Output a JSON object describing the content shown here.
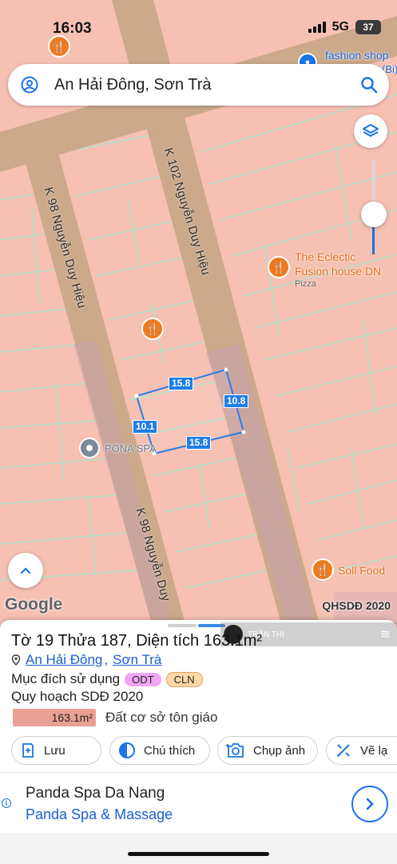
{
  "status": {
    "time": "16:03",
    "network": "5G",
    "battery": "37"
  },
  "search": {
    "query": "An Hải Đông, Sơn Trà"
  },
  "map": {
    "streets": {
      "left_upper": "K 98 Nguyễn Duy Hiệu",
      "center": "K 102 Nguyễn Duy Hiệu",
      "left_lower": "K 98 Nguyễn Duy"
    },
    "pois": {
      "fashion_shop": "fashion shop",
      "fashion_shop_suffix": "Bi",
      "eclectic": "The Eclectic Fusion house DN",
      "eclectic_type": "Pizza",
      "pona": "PONA SPA",
      "soll": "Soll Food"
    },
    "dimensions": {
      "top": "15.8",
      "right": "10.8",
      "left": "10.1",
      "bottom": "15.8"
    },
    "google": "Google",
    "plan_layer": "QHSDĐ 2020"
  },
  "sheet": {
    "title": "Tờ 19 Thửa 187, Diện tích 163.1m²",
    "address": {
      "ward": "An Hải Đông",
      "sep": ",",
      "district": "Sơn Trà"
    },
    "purpose_label": "Mục đích sử dụng",
    "badges": [
      {
        "text": "ODT",
        "color": "#f0a6f2"
      },
      {
        "text": "CLN",
        "color": "#ffd9a6"
      }
    ],
    "plan_label": "Quy hoạch SDĐ 2020",
    "area_value": "163.1m²",
    "area_desc": "Đất cơ sở tôn giáo",
    "actions": {
      "save": "Lưu",
      "legend": "Chú thích",
      "capture": "Chụp ảnh",
      "draw": "Vẽ lạ"
    },
    "watermark": "TRẦN THỊ",
    "ad": {
      "name": "Panda Spa Da Nang",
      "subtitle": "Panda Spa & Massage"
    }
  },
  "colors": {
    "accent": "#1a73e8",
    "road": "#c9a888",
    "parcel": "#f6c1b2",
    "parcel_line": "#9fe0c9",
    "poi": "#ef7a1d"
  }
}
